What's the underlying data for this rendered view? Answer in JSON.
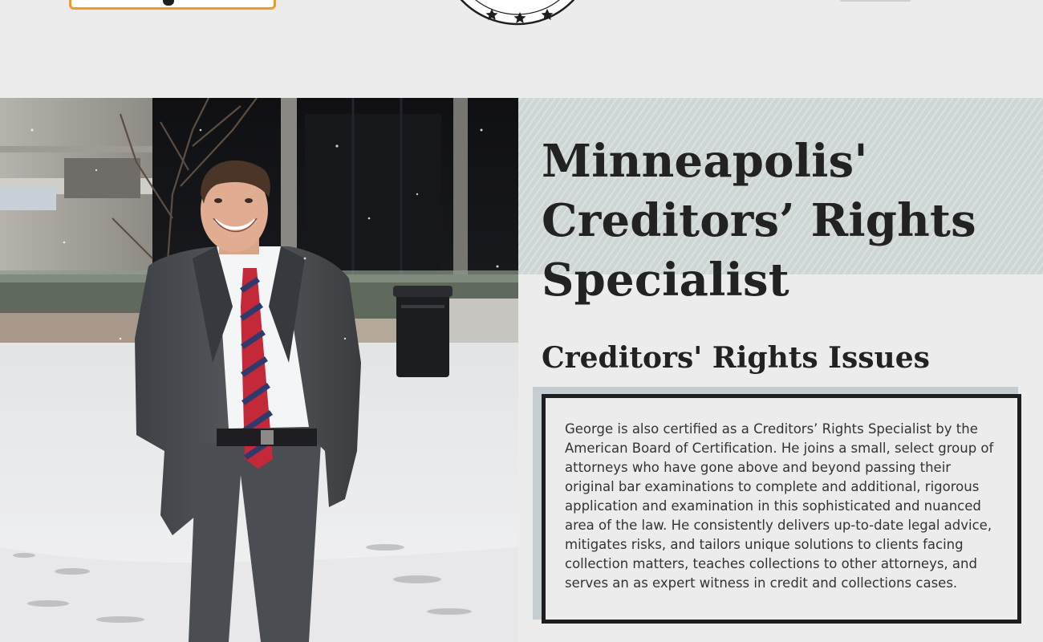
{
  "header": {
    "logo_icon": "brand-logo-box",
    "seal_icon": "certification-seal-icon",
    "colors": {
      "logo_border": "#f39b1f",
      "background": "#ececec"
    }
  },
  "hero": {
    "photo_alt": "Photo of attorney in a grey suit and striped tie standing in a snowy plaza",
    "title": "Minneapolis' Creditors’ Rights Specialist",
    "subtitle": "Creditors' Rights Issues",
    "body": "George is also certified as a Creditors’ Rights Specialist by the American Board of Certification. He joins a small, select group of attorneys who have gone above and beyond passing their original bar examinations to complete and additional, rigorous application and examination in this sophisticated and nuanced area of the law. He consistently delivers up-to-date legal advice, mitigates risks, and tailors unique solutions to clients facing collection matters, teaches collections to other attorneys, and serves an as expert witness in credit and collections cases."
  },
  "colors": {
    "pattern_band": "#cdd6d4",
    "card_border": "#1e1e1e",
    "card_shadow": "#c3cdd2",
    "text": "#222222"
  }
}
